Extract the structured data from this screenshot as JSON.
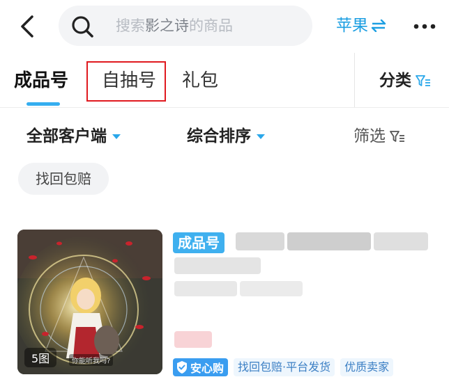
{
  "header": {
    "back_icon": "chevron-left-icon",
    "search_prefix": "搜索",
    "search_highlight": "影之诗",
    "search_suffix": "的商品",
    "platform_label": "苹果",
    "platform_icon": "swap-icon",
    "more_icon": "more-dots-icon"
  },
  "tabs": {
    "items": [
      {
        "label": "成品号",
        "active": true
      },
      {
        "label": "自抽号",
        "active": false,
        "highlighted": true
      },
      {
        "label": "礼包",
        "active": false
      }
    ],
    "category_label": "分类",
    "accent_color": "#35aef0",
    "highlight_color": "#e0191f"
  },
  "filters": {
    "client": "全部客户端",
    "sort": "综合排序",
    "filter": "筛选"
  },
  "chips": {
    "recover_compensation": "找回包赔"
  },
  "listing": {
    "image_count": "5图",
    "image_caption": "你能听我吗?",
    "type_badge": "成品号",
    "tag_secure": "安心购",
    "tag_service": "找回包赔·平台发货",
    "tag_seller": "优质卖家"
  }
}
